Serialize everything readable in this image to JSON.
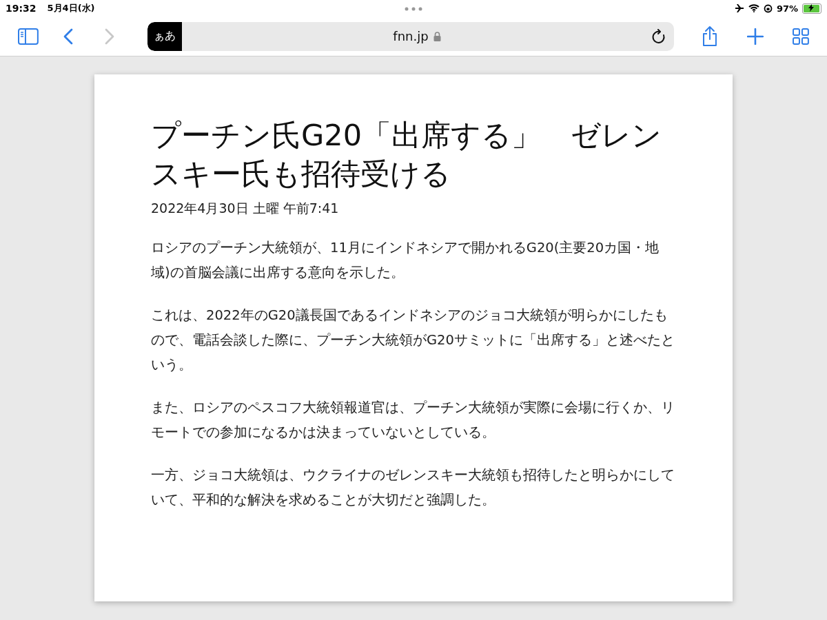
{
  "status_bar": {
    "time": "19:32",
    "date": "5月4日(水)",
    "battery_text": "97%",
    "battery": {
      "level": 0.97,
      "charging": true
    }
  },
  "toolbar": {
    "back_enabled": true,
    "forward_enabled": false,
    "reader_button": "ぁあ",
    "url": "fnn.jp",
    "secure": true
  },
  "article": {
    "title": "プーチン氏G20「出席する」　ゼレンスキー氏も招待受ける",
    "date": "2022年4月30日 土曜 午前7:41",
    "paragraphs": [
      "ロシアのプーチン大統領が、11月にインドネシアで開かれるG20(主要20カ国・地域)の首脳会議に出席する意向を示した。",
      "これは、2022年のG20議長国であるインドネシアのジョコ大統領が明らかにしたもので、電話会談した際に、プーチン大統領がG20サミットに「出席する」と述べたという。",
      "また、ロシアのペスコフ大統領報道官は、プーチン大統領が実際に会場に行くか、リモートでの参加になるかは決まっていないとしている。",
      "一方、ジョコ大統領は、ウクライナのゼレンスキー大統領も招待したと明らかにしていて、平和的な解決を求めることが大切だと強調した。"
    ]
  }
}
